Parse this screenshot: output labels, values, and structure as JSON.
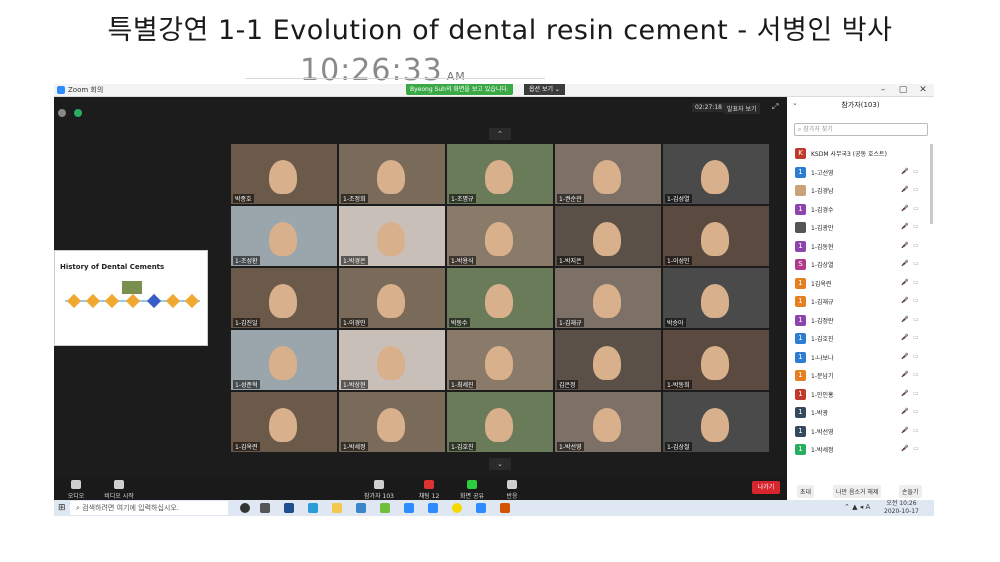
{
  "page_title": "특별강연 1-1 Evolution of dental resin cement - 서병인 박사",
  "clock": {
    "time": "10:26:33",
    "ampm": "AM"
  },
  "window": {
    "title": "Zoom 회의",
    "share_banner": "Byeong Suh의 화면을 보고 있습니다.",
    "view_options": "옵션 보기 ⌄",
    "timer": "02:27:18",
    "speaker_view": "발표자 보기",
    "min_symbol": "–",
    "max_symbol": "▢",
    "close_symbol": "✕",
    "fullscreen_symbol": "⤢",
    "arrow_up": "⌃",
    "arrow_down": "⌄"
  },
  "shared_slide": {
    "title": "History of Dental Cements"
  },
  "tiles": [
    {
      "name": "박종호"
    },
    {
      "name": "1-조정희"
    },
    {
      "name": "1-조명규"
    },
    {
      "name": "1-권순관"
    },
    {
      "name": "1-김성열"
    },
    {
      "name": "1-조성환"
    },
    {
      "name": "1-박경은"
    },
    {
      "name": "1-박용식"
    },
    {
      "name": "1-박지은"
    },
    {
      "name": "1-이성민"
    },
    {
      "name": "1-김진일"
    },
    {
      "name": "1-이경민"
    },
    {
      "name": "박동수"
    },
    {
      "name": "1-김재규"
    },
    {
      "name": "박승아"
    },
    {
      "name": "1-성준혁"
    },
    {
      "name": "1-박상현"
    },
    {
      "name": "1-최세진"
    },
    {
      "name": "김은정"
    },
    {
      "name": "1-박동희"
    },
    {
      "name": "1-김옥련"
    },
    {
      "name": "1-박세정"
    },
    {
      "name": "1-김호진"
    },
    {
      "name": "1-박선영"
    },
    {
      "name": "1-김상철"
    }
  ],
  "toolbar": {
    "audio": "오디오",
    "video": "비디오 시작",
    "participants": "참가자",
    "participants_count": "103",
    "chat": "채팅",
    "chat_badge": "12",
    "share": "화면 공유",
    "reactions": "반응",
    "leave": "나가기"
  },
  "panel": {
    "header": "참가자(103)",
    "search_placeholder": "참가자 찾기",
    "collapse_symbol": "⌄",
    "participants": [
      {
        "initial": "K사",
        "name": "KSDM 사무국3 (공동 호스트)",
        "color": "#c0392b"
      },
      {
        "initial": "1",
        "name": "1-고선영",
        "color": "#2d7dd2"
      },
      {
        "initial": "",
        "name": "1-김경남",
        "color": "#c9a27a"
      },
      {
        "initial": "1",
        "name": "1-김경수",
        "color": "#8e44ad"
      },
      {
        "initial": "",
        "name": "1-김광만",
        "color": "#555555"
      },
      {
        "initial": "1",
        "name": "1-김동현",
        "color": "#8e44ad"
      },
      {
        "initial": "S",
        "name": "1-김상열",
        "color": "#b03a8c"
      },
      {
        "initial": "1",
        "name": "1김옥련",
        "color": "#e67e22"
      },
      {
        "initial": "1",
        "name": "1-김재규",
        "color": "#e67e22"
      },
      {
        "initial": "1",
        "name": "1-김정란",
        "color": "#8e44ad"
      },
      {
        "initial": "1",
        "name": "1-김호진",
        "color": "#2d7dd2"
      },
      {
        "initial": "1",
        "name": "1-나보나",
        "color": "#2d7dd2"
      },
      {
        "initial": "1",
        "name": "1-문남기",
        "color": "#e67e22"
      },
      {
        "initial": "1",
        "name": "1-민인홍",
        "color": "#c0392b"
      },
      {
        "initial": "1",
        "name": "1-박광",
        "color": "#34495e"
      },
      {
        "initial": "1",
        "name": "1-박선영",
        "color": "#34495e"
      },
      {
        "initial": "1",
        "name": "1-박세정",
        "color": "#27ae60"
      }
    ],
    "btn_invite": "초대",
    "btn_unmute": "나만 음소거 해제",
    "btn_raise": "손들기"
  },
  "taskbar": {
    "search_placeholder": "검색하려면 여기에 입력하십시오.",
    "tray_lang": "A",
    "time": "오전 10:26",
    "date": "2020-10-17"
  }
}
